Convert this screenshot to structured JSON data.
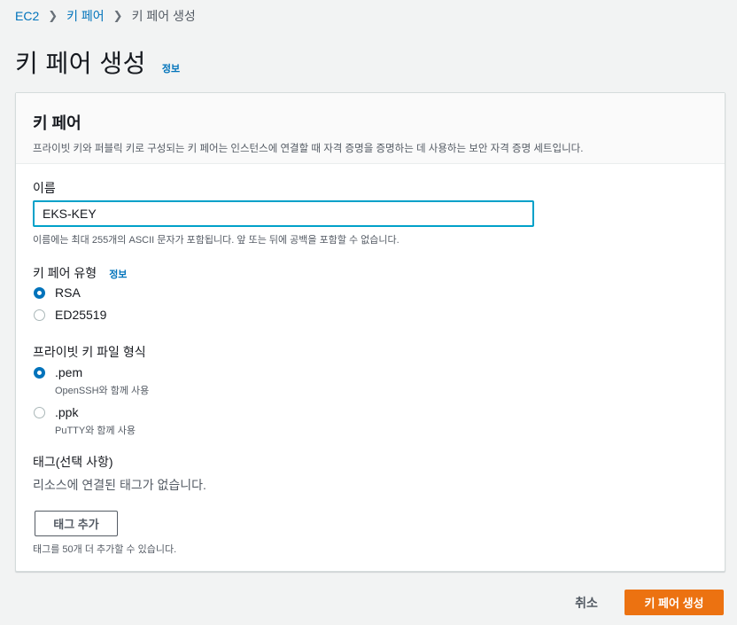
{
  "breadcrumb": {
    "items": [
      "EC2",
      "키 페어"
    ],
    "current": "키 페어 생성"
  },
  "page": {
    "title": "키 페어 생성",
    "info": "정보"
  },
  "card": {
    "title": "키 페어",
    "description": "프라이빗 키와 퍼블릭 키로 구성되는 키 페어는 인스턴스에 연결할 때 자격 증명을 증명하는 데 사용하는 보안 자격 증명 세트입니다."
  },
  "name_field": {
    "label": "이름",
    "value": "EKS-KEY",
    "hint": "이름에는 최대 255개의 ASCII 문자가 포함됩니다. 앞 또는 뒤에 공백을 포함할 수 없습니다."
  },
  "key_type": {
    "label": "키 페어 유형",
    "info": "정보",
    "options": [
      {
        "label": "RSA",
        "selected": true
      },
      {
        "label": "ED25519",
        "selected": false
      }
    ]
  },
  "file_format": {
    "label": "프라이빗 키 파일 형식",
    "options": [
      {
        "label": ".pem",
        "description": "OpenSSH와 함께 사용",
        "selected": true
      },
      {
        "label": ".ppk",
        "description": "PuTTY와 함께 사용",
        "selected": false
      }
    ]
  },
  "tags": {
    "label": "태그(선택 사항)",
    "empty_text": "리소스에 연결된 태그가 없습니다.",
    "add_button": "태그 추가",
    "hint": "태그를 50개 더 추가할 수 있습니다."
  },
  "actions": {
    "cancel": "취소",
    "submit": "키 페어 생성"
  },
  "colors": {
    "link": "#0073bb",
    "primary": "#ec7211",
    "focus": "#00a1c9"
  }
}
